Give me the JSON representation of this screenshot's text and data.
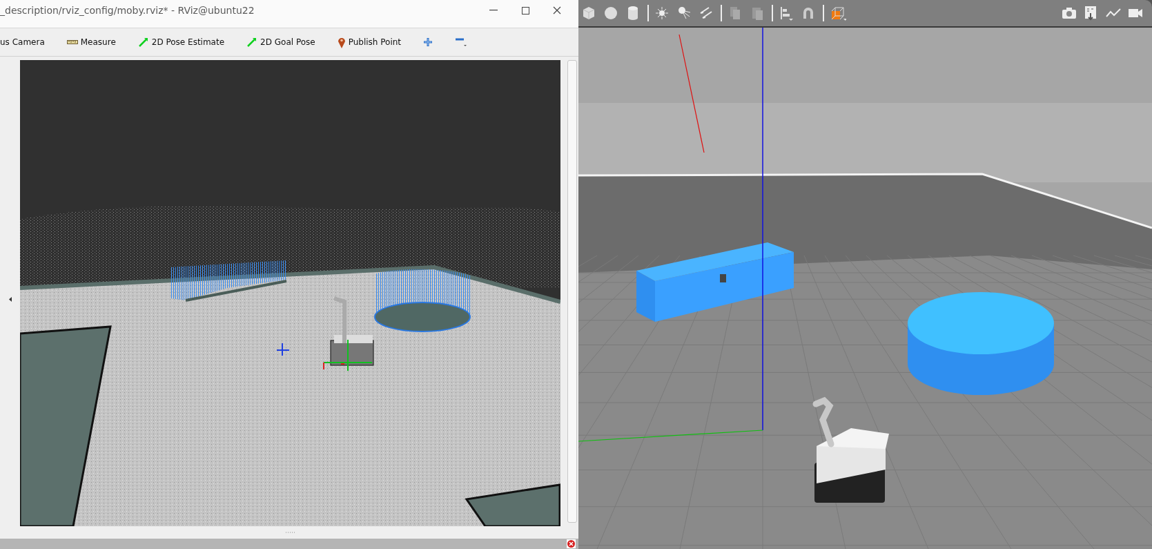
{
  "rviz": {
    "title": "_description/rviz_config/moby.rviz* - RViz@ubuntu22",
    "tools": [
      {
        "kind": "text",
        "label": "us Camera"
      },
      {
        "kind": "measure",
        "label": "Measure"
      },
      {
        "kind": "arrow",
        "label": "2D Pose Estimate"
      },
      {
        "kind": "arrow",
        "label": "2D Goal Pose"
      },
      {
        "kind": "pin",
        "label": "Publish Point"
      },
      {
        "kind": "plus"
      },
      {
        "kind": "minus"
      }
    ]
  }
}
